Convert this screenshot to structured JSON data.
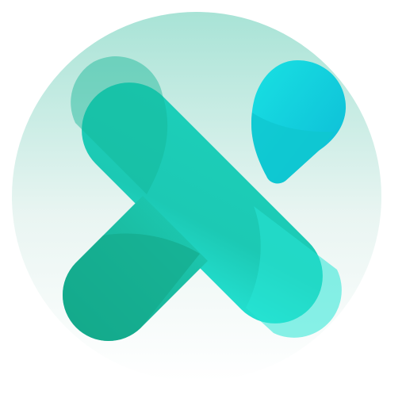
{
  "icon": {
    "name": "x-logo-icon",
    "elements": [
      "background-circle",
      "x-mark",
      "drop-accent"
    ]
  },
  "colors": {
    "circle_top": "#a8e3d6",
    "circle_bottom": "#ffffff",
    "stroke_dark": "#14a98b",
    "stroke_mid": "#1ccfb9",
    "stroke_light": "#24e3d4",
    "drop_light": "#19e1e3",
    "drop_dark": "#0cbad6",
    "drop_fold": "#0fc7d0"
  }
}
